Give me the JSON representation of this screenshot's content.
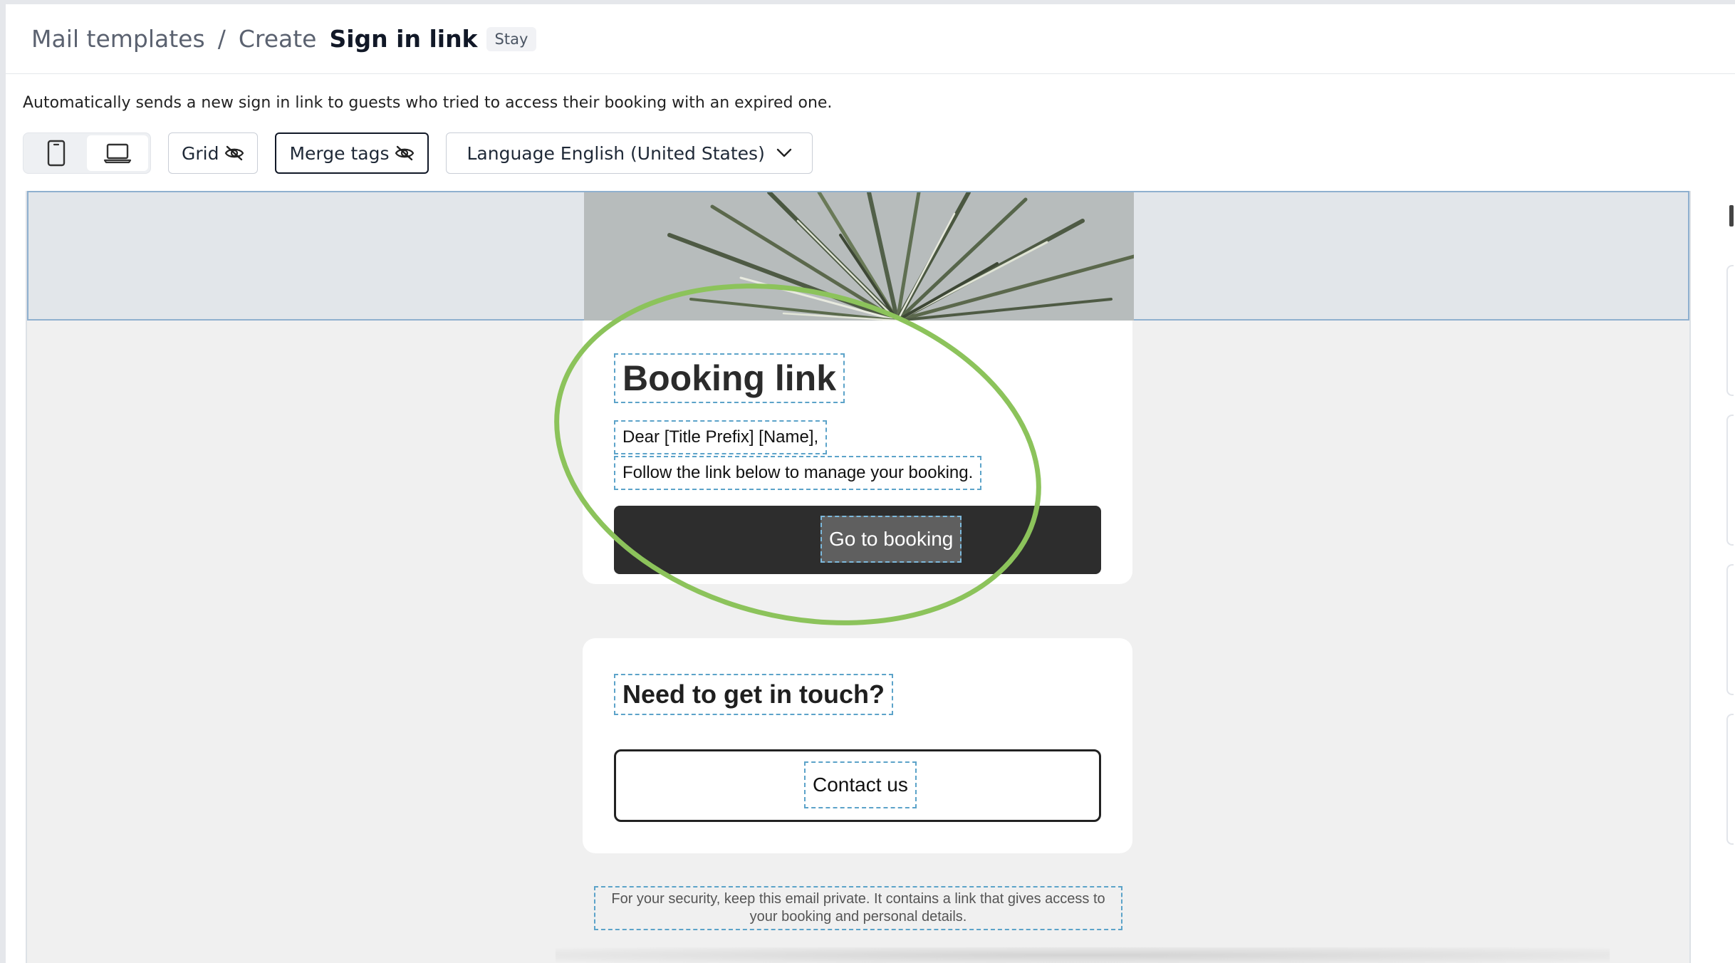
{
  "header": {
    "breadcrumb_root": "Mail templates",
    "breadcrumb_separator": "/",
    "breadcrumb_middle": "Create",
    "breadcrumb_current": "Sign in link",
    "badge": "Stay"
  },
  "description": "Automatically sends a new sign in link to guests who tried to access their booking with an expired one.",
  "toolbar": {
    "grid_label": "Grid",
    "merge_tags_label": "Merge tags",
    "language_label": "Language English (United States)"
  },
  "email": {
    "heading": "Booking link",
    "greeting": "Dear [Title Prefix] [Name],",
    "body": "Follow the link below to manage your booking.",
    "cta_label": "Go to booking",
    "contact_heading": "Need to get in touch?",
    "contact_button": "Contact us",
    "security_note": "For your security, keep this email private. It contains a link that gives access to your booking and personal details."
  },
  "colors": {
    "annotation_ellipse": "#8cc35b",
    "dashed_outline": "#5ca3c9",
    "cta_background": "#2d2d2d"
  }
}
